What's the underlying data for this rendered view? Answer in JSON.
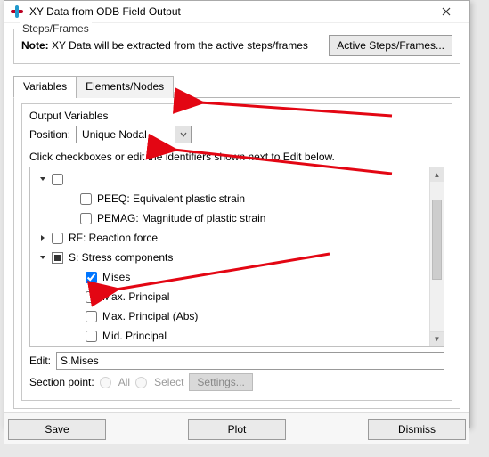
{
  "title": "XY Data from ODB Field Output",
  "steps": {
    "legend": "Steps/Frames",
    "note_label": "Note:",
    "note_text": " XY Data will be extracted from the active steps/frames",
    "button": "Active Steps/Frames..."
  },
  "tabs": {
    "variables": "Variables",
    "elements_nodes": "Elements/Nodes"
  },
  "output": {
    "legend": "Output Variables",
    "position_label": "Position:",
    "position_value": "Unique Nodal",
    "hint": "Click checkboxes or edit the identifiers shown next to Edit below.",
    "items": {
      "peeq": "PEEQ: Equivalent plastic strain",
      "pemag": "PEMAG: Magnitude of plastic strain",
      "rf": "RF: Reaction force",
      "s": "S: Stress components",
      "mises": "Mises",
      "maxp": "Max. Principal",
      "maxpa": "Max. Principal (Abs)",
      "midp": "Mid. Principal"
    },
    "edit_label": "Edit:",
    "edit_value": "S.Mises",
    "section_label": "Section point:",
    "radio_all": "All",
    "radio_select": "Select",
    "settings": "Settings..."
  },
  "buttons": {
    "save": "Save",
    "plot": "Plot",
    "dismiss": "Dismiss"
  }
}
